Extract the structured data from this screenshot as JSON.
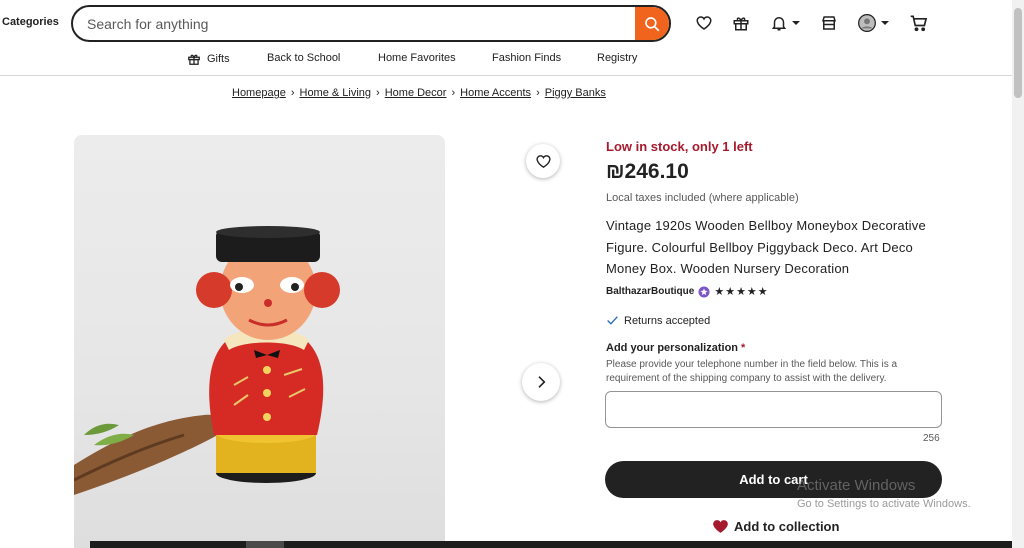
{
  "header": {
    "categories_label": "Categories",
    "search_placeholder": "Search for anything",
    "icons": [
      "search-icon",
      "heart-icon",
      "gift-icon",
      "bell-icon",
      "shop-icon",
      "avatar",
      "cart-icon"
    ],
    "accent_color": "#f1641e"
  },
  "nav": {
    "gifts": "Gifts",
    "back_to_school": "Back to School",
    "home_favorites": "Home Favorites",
    "fashion_finds": "Fashion Finds",
    "registry": "Registry"
  },
  "breadcrumb": [
    "Homepage",
    "Home & Living",
    "Home Decor",
    "Home Accents",
    "Piggy Banks"
  ],
  "listing": {
    "stock_message": "Low in stock, only 1 left",
    "price": "₪246.10",
    "tax_note": "Local taxes included (where applicable)",
    "title": "Vintage 1920s Wooden Bellboy Moneybox Decorative Figure. Colourful Bellboy Piggyback Deco. Art Deco Money Box. Wooden Nursery Decoration",
    "shop_name": "BalthazarBoutique",
    "stars": "★★★★★",
    "rating": 5,
    "returns": "Returns accepted",
    "personalization_label": "Add your personalization",
    "required_mark": "*",
    "personalization_help": "Please provide your telephone number in the field below. This is a requirement of the shipping company to assist with the delivery.",
    "personalization_value": "",
    "char_count": "256",
    "add_to_cart": "Add to cart",
    "add_to_collection": "Add to collection",
    "stock_color": "#a61a2e"
  },
  "watermark": {
    "title": "Activate Windows",
    "subtitle": "Go to Settings to activate Windows."
  }
}
